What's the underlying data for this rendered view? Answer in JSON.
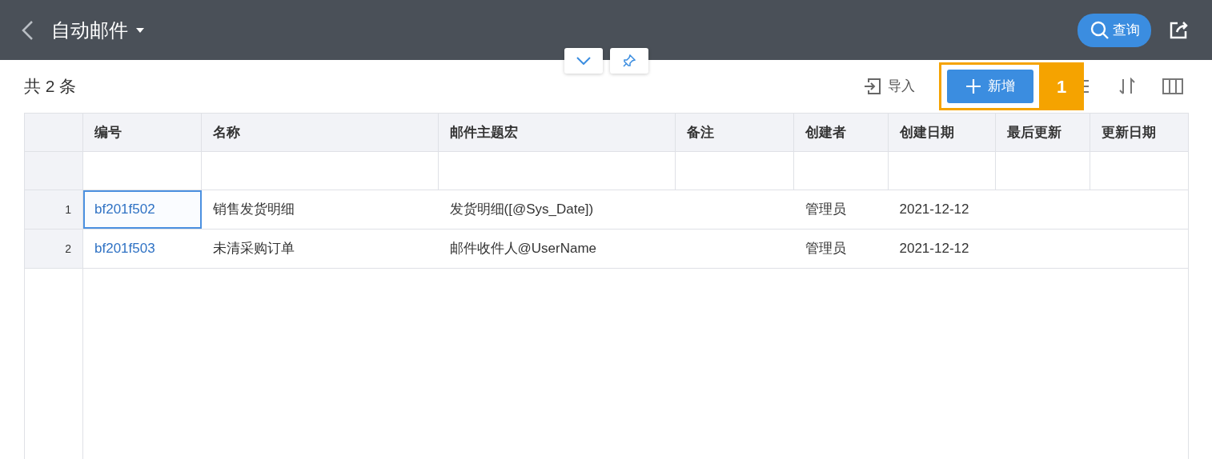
{
  "header": {
    "title": "自动邮件",
    "search_button": "查询"
  },
  "toolbar": {
    "count": "共 2 条",
    "import_button": "导入",
    "add_button": "新增",
    "callout": "1"
  },
  "table": {
    "columns": [
      "编号",
      "名称",
      "邮件主题宏",
      "备注",
      "创建者",
      "创建日期",
      "最后更新",
      "更新日期"
    ],
    "rows": [
      {
        "index": "1",
        "selected": true,
        "cells": [
          "bf201f502",
          "销售发货明细",
          "发货明细([@Sys_Date])",
          "",
          "管理员",
          "2021-12-12",
          "",
          ""
        ]
      },
      {
        "index": "2",
        "selected": false,
        "cells": [
          "bf201f503",
          "未清采购订单",
          "邮件收件人@UserName",
          "",
          "管理员",
          "2021-12-12",
          "",
          ""
        ]
      }
    ]
  }
}
